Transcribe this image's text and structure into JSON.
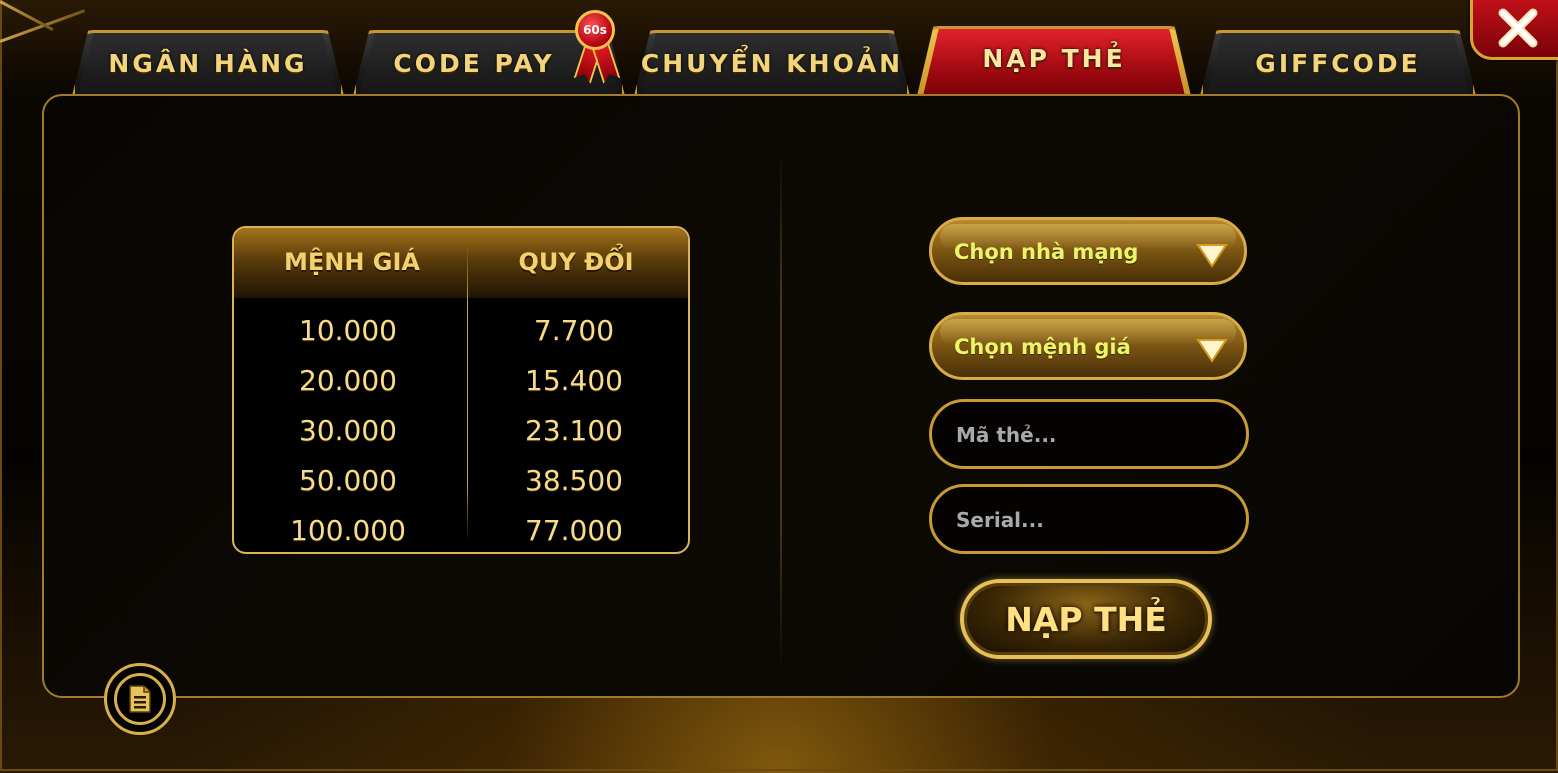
{
  "tabs": [
    {
      "label": "NGÂN HÀNG",
      "active": false
    },
    {
      "label": "CODE PAY",
      "active": false,
      "badge": "60s"
    },
    {
      "label": "CHUYỂN KHOẢN",
      "active": false
    },
    {
      "label": "NẠP THẺ",
      "active": true
    },
    {
      "label": "GIFFCODE",
      "active": false
    }
  ],
  "rates": {
    "header_left": "MỆNH GIÁ",
    "header_right": "QUY ĐỔI",
    "rows": [
      {
        "value": "10.000",
        "exchange": "7.700"
      },
      {
        "value": "20.000",
        "exchange": "15.400"
      },
      {
        "value": "30.000",
        "exchange": "23.100"
      },
      {
        "value": "50.000",
        "exchange": "38.500"
      },
      {
        "value": "100.000",
        "exchange": "77.000"
      }
    ]
  },
  "form": {
    "network_select": "Chọn nhà mạng",
    "denomination_select": "Chọn mệnh giá",
    "card_code_placeholder": "Mã thẻ...",
    "serial_placeholder": "Serial...",
    "submit_label": "NẠP THẺ"
  },
  "icons": {
    "close": "close-icon",
    "history": "document-icon",
    "dropdown": "triangle-down-icon"
  },
  "colors": {
    "gold": "#d8ac46",
    "active_tab": "#c2101a",
    "select_text": "#ecf46a"
  }
}
